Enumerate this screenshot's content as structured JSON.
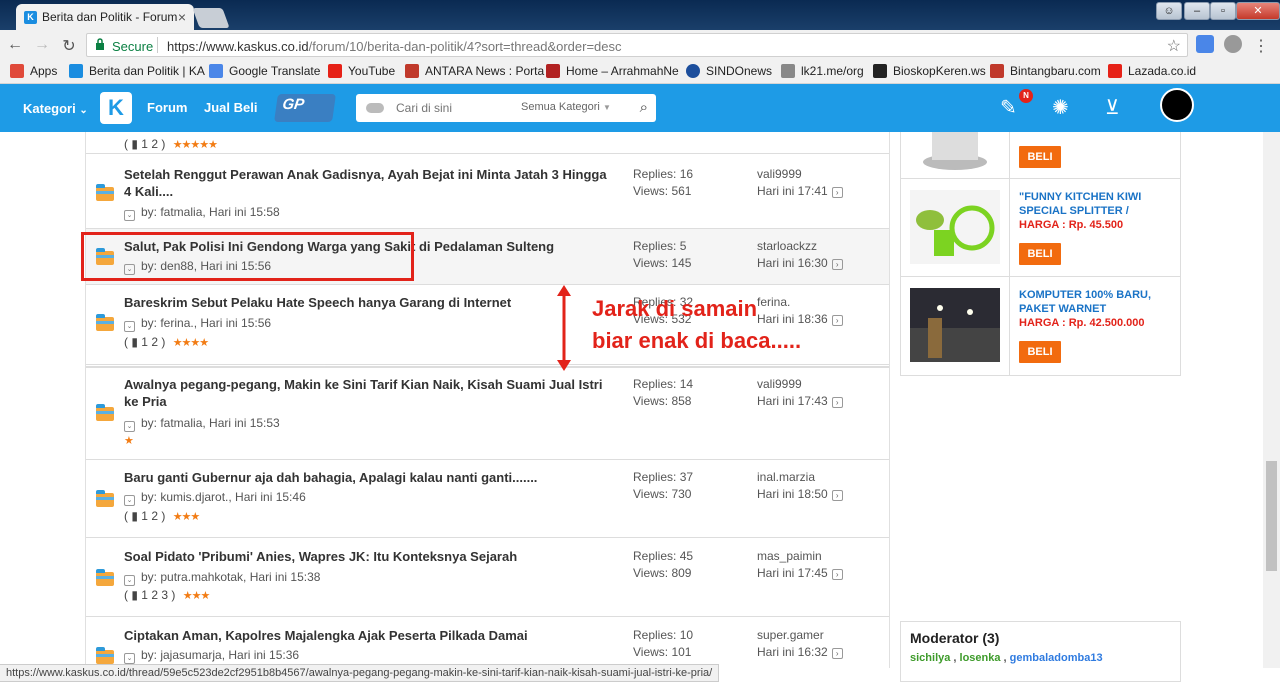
{
  "browser": {
    "tab_title": "Berita dan Politik - Forum",
    "secure_label": "Secure",
    "url_host": "https://www.kaskus.co.id",
    "url_path": "/forum/10/berita-dan-politik/4?sort=thread&order=desc",
    "status_url": "https://www.kaskus.co.id/thread/59e5c523de2cf2951b8b4567/awalnya-pegang-pegang-makin-ke-sini-tarif-kian-naik-kisah-suami-jual-istri-ke-pria/"
  },
  "bookmarks": [
    {
      "label": "Apps",
      "icon": "apps-grid-icon",
      "color": "#e04a3a"
    },
    {
      "label": "Berita dan Politik | KA",
      "icon": "kaskus-icon",
      "color": "#1a8de0"
    },
    {
      "label": "Google Translate",
      "icon": "translate-icon",
      "color": "#4a86e8"
    },
    {
      "label": "YouTube",
      "icon": "youtube-icon",
      "color": "#e62117"
    },
    {
      "label": "ANTARA News : Porta",
      "icon": "antara-icon",
      "color": "#c0392b"
    },
    {
      "label": "Home – ArrahmahNe",
      "icon": "arrahmah-icon",
      "color": "#b22222"
    },
    {
      "label": "SINDOnews",
      "icon": "sindonews-icon",
      "color": "#1c4e9c"
    },
    {
      "label": "lk21.me/org",
      "icon": "lk21-icon",
      "color": "#888888"
    },
    {
      "label": "BioskopKeren.ws",
      "icon": "bioskopkeren-icon",
      "color": "#222222"
    },
    {
      "label": "Bintangbaru.com",
      "icon": "bintangbaru-icon",
      "color": "#c0392b"
    },
    {
      "label": "Lazada.co.id",
      "icon": "lazada-icon",
      "color": "#e62117"
    }
  ],
  "header": {
    "kategori": "Kategori",
    "nav_forum": "Forum",
    "nav_jualbeli": "Jual Beli",
    "gp_logo": "GP",
    "search_placeholder": "Cari di sini",
    "search_category": "Semua Kategori",
    "notif_badge": "N",
    "accent_color": "#1e9be6"
  },
  "threads": [
    {
      "title": "",
      "by": "",
      "pages": [
        "1",
        "2"
      ],
      "stars": "★★★★★",
      "replies": "",
      "views": "",
      "last_user": "",
      "last_time": "",
      "partial": true
    },
    {
      "title": "Setelah Renggut Perawan Anak Gadisnya, Ayah Bejat ini Minta Jatah 3 Hingga 4 Kali....",
      "by": "fatmalia, Hari ini 15:58",
      "replies": "Replies: 16",
      "views": "Views: 561",
      "last_user": "vali9999",
      "last_time": "Hari ini 17:41"
    },
    {
      "title": "Salut, Pak Polisi Ini Gendong Warga yang Sakit di Pedalaman Sulteng",
      "by": "den88, Hari ini 15:56",
      "replies": "Replies: 5",
      "views": "Views: 145",
      "last_user": "starloackzz",
      "last_time": "Hari ini 16:30"
    },
    {
      "title": "Bareskrim Sebut Pelaku Hate Speech hanya Garang di Internet",
      "by": "ferina., Hari ini 15:56",
      "pages": [
        "1",
        "2"
      ],
      "stars": "★★★★",
      "replies": "Replies: 32",
      "views": "Views: 532",
      "last_user": "ferina.",
      "last_time": "Hari ini 18:36"
    },
    {
      "title": "Awalnya pegang-pegang, Makin ke Sini Tarif Kian Naik, Kisah Suami Jual Istri ke Pria",
      "by": "fatmalia, Hari ini 15:53",
      "stars": "★",
      "replies": "Replies: 14",
      "views": "Views: 858",
      "last_user": "vali9999",
      "last_time": "Hari ini 17:43"
    },
    {
      "title": "Baru ganti Gubernur aja dah bahagia, Apalagi kalau nanti ganti.......",
      "by": "kumis.djarot., Hari ini 15:46",
      "pages": [
        "1",
        "2"
      ],
      "stars": "★★★",
      "replies": "Replies: 37",
      "views": "Views: 730",
      "last_user": "inal.marzia",
      "last_time": "Hari ini 18:50"
    },
    {
      "title": "Soal Pidato 'Pribumi' Anies, Wapres JK: Itu Konteksnya Sejarah",
      "by": "putra.mahkotak, Hari ini 15:38",
      "pages": [
        "1",
        "2",
        "3"
      ],
      "stars": "★★★",
      "replies": "Replies: 45",
      "views": "Views: 809",
      "last_user": "mas_paimin",
      "last_time": "Hari ini 17:45"
    },
    {
      "title": "Ciptakan Aman, Kapolres Majalengka Ajak Peserta Pilkada Damai",
      "by": "jajasumarja, Hari ini 15:36",
      "replies": "Replies: 10",
      "views": "Views: 101",
      "last_user": "super.gamer",
      "last_time": "Hari ini 16:32"
    }
  ],
  "annotation": {
    "line1": "Jarak di samain",
    "line2": "biar enak di baca.....",
    "color": "#e2231a"
  },
  "products": [
    {
      "name": "",
      "price": "",
      "beli": "BELI"
    },
    {
      "name": "\"FUNNY KITCHEN KIWI SPECIAL SPLITTER /",
      "price": "HARGA : Rp. 45.500",
      "beli": "BELI"
    },
    {
      "name": "KOMPUTER 100% BARU, PAKET WARNET",
      "price": "HARGA : Rp. 42.500.000",
      "beli": "BELI"
    }
  ],
  "moderator": {
    "title": "Moderator (3)",
    "names": [
      "sichilya",
      "losenka",
      "gembaladomba13"
    ]
  }
}
